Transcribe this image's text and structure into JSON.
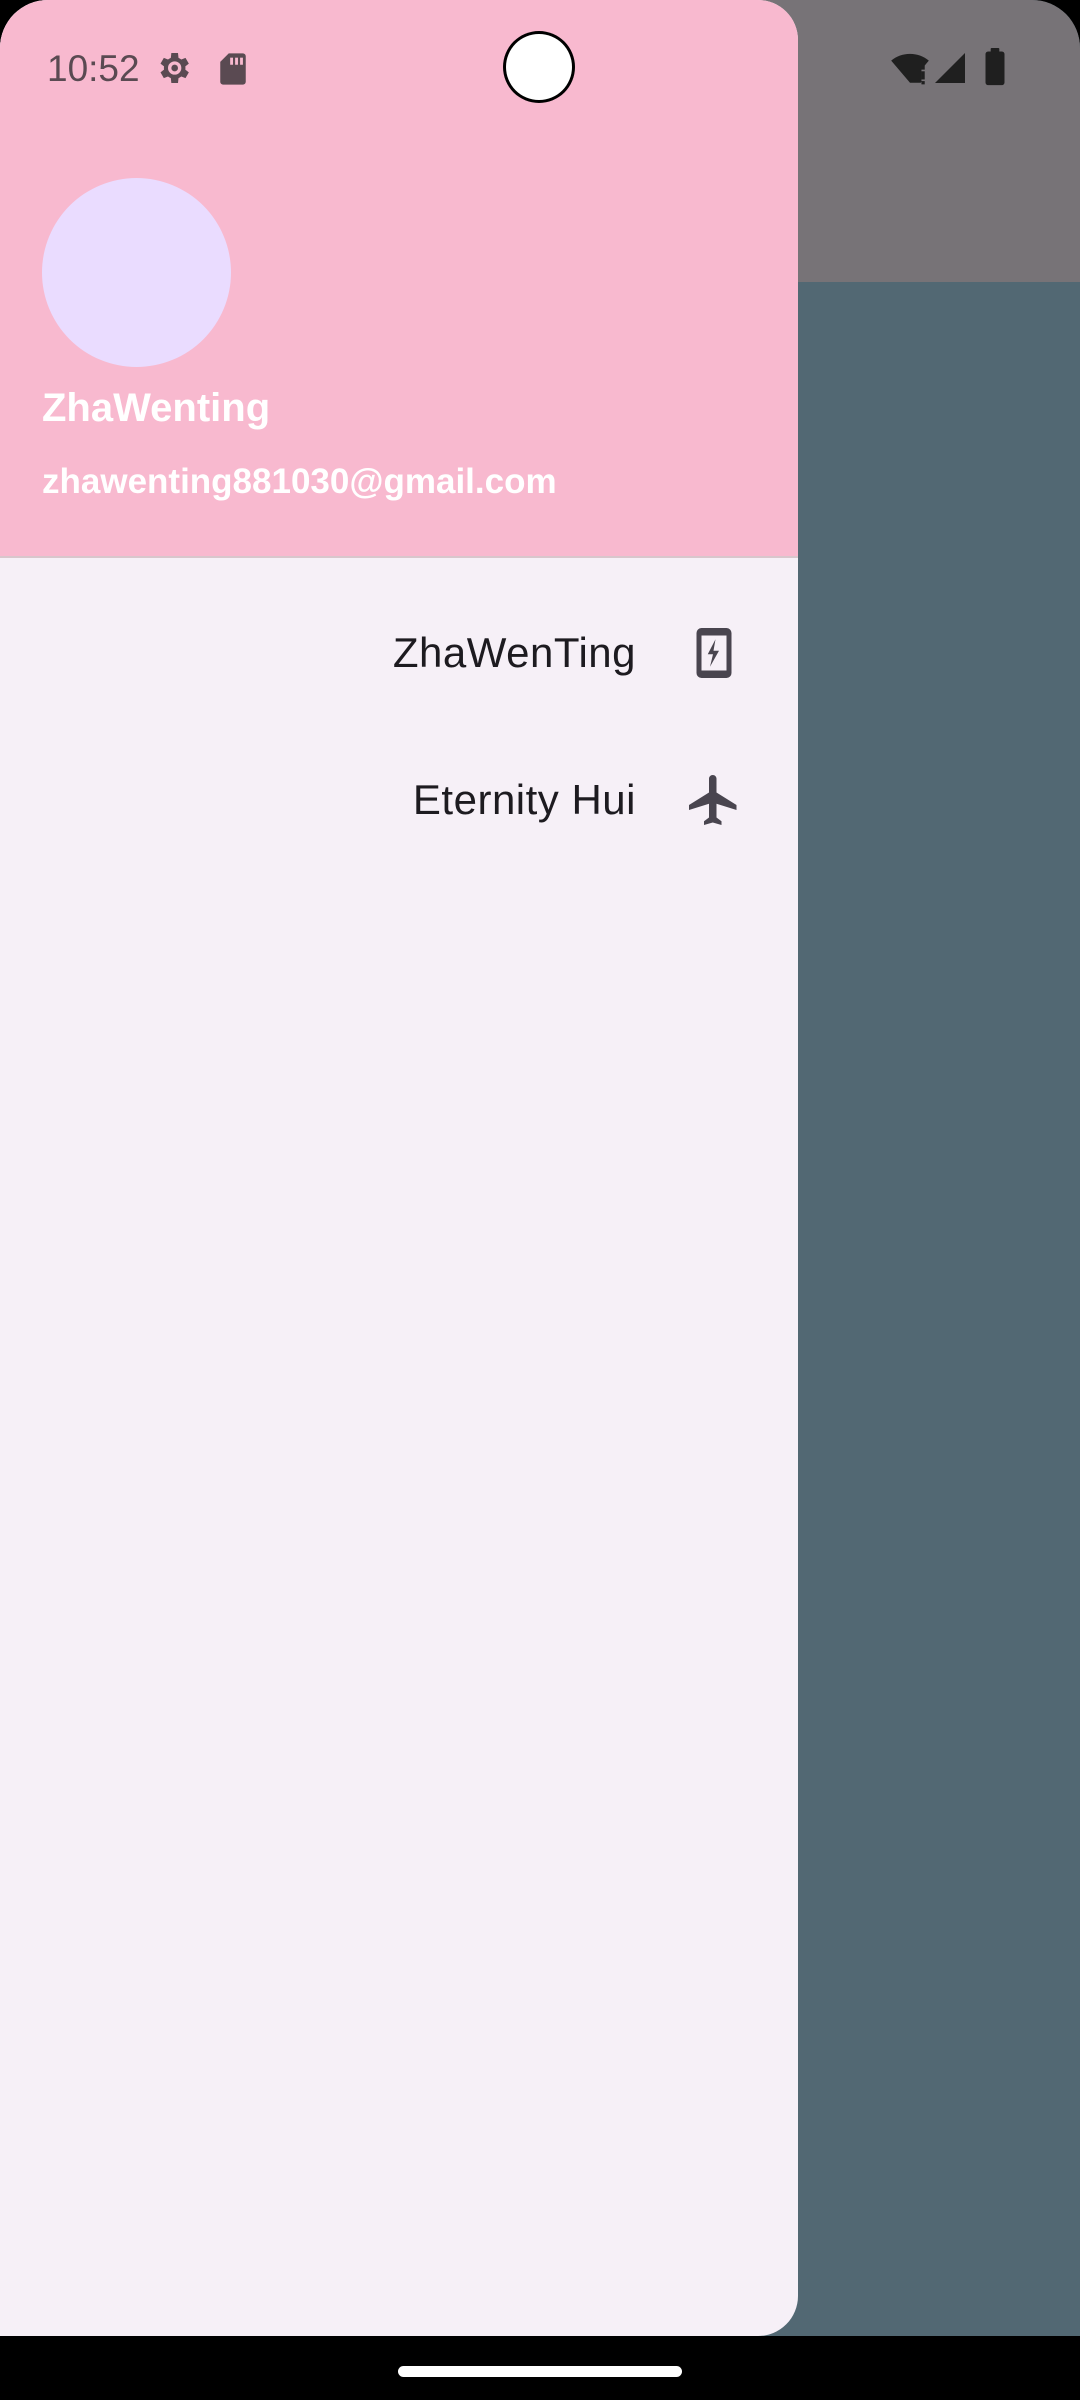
{
  "status_bar": {
    "time": "10:52",
    "left_icons": [
      "settings-gear-icon",
      "sd-card-icon"
    ],
    "right_icons": [
      "wifi-alert-icon",
      "cellular-signal-icon",
      "battery-icon"
    ]
  },
  "drawer": {
    "header": {
      "account_name": "ZhaWenting",
      "account_email": "zhawenting881030@gmail.com",
      "background_color": "#f8b9cf",
      "avatar_color": "#eadcff"
    },
    "items": [
      {
        "label": "ZhaWenTing",
        "icon": "phone-charging-icon"
      },
      {
        "label": "Eternity Hui",
        "icon": "airplane-icon"
      }
    ],
    "background_color": "#f6f0f7"
  },
  "scrim_color": "#526873"
}
